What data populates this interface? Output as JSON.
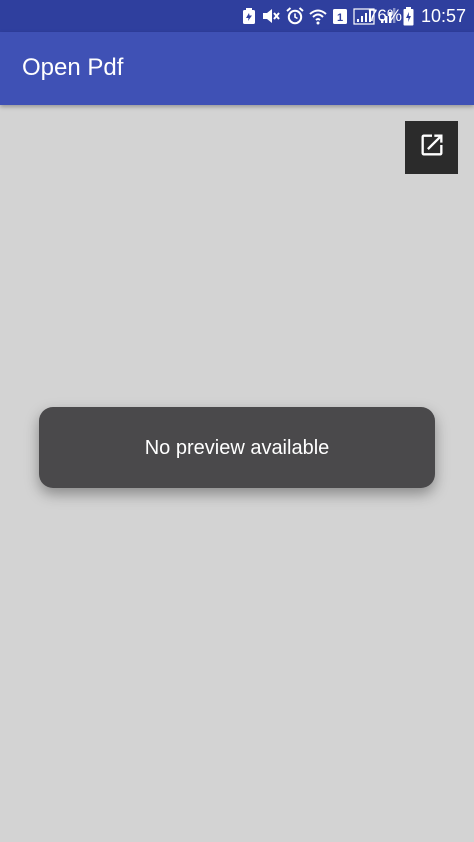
{
  "status_bar": {
    "battery_percent": "76%",
    "time": "10:57",
    "sim_badge": "1",
    "background_color": "#2f3f9e",
    "icons": [
      "battery-saver-icon",
      "mute-icon",
      "alarm-icon",
      "wifi-icon",
      "sim-badge-icon",
      "signal-icon",
      "signal-weak-icon",
      "battery-charging-icon"
    ]
  },
  "app_bar": {
    "title": "Open Pdf",
    "background_color": "#3f51b5"
  },
  "toolbar": {
    "open_external_icon": "open-in-new-icon"
  },
  "preview": {
    "message": "No preview available",
    "background_color": "#d3d3d3"
  }
}
